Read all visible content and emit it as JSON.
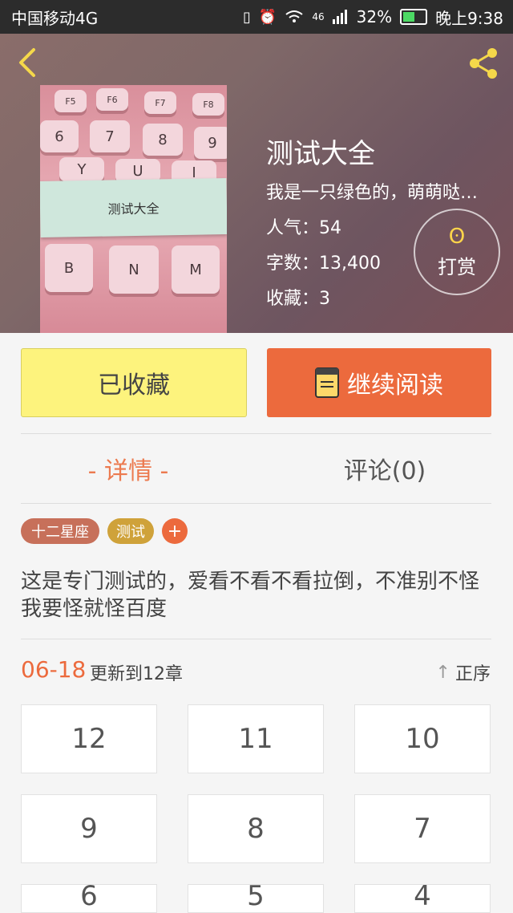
{
  "status_bar": {
    "carrier": "中国移动4G",
    "signal_label": "46",
    "battery_percent": "32%",
    "time": "晚上9:38",
    "icons": [
      "vibrate-icon",
      "alarm-icon",
      "wifi-icon",
      "signal-icon",
      "battery-icon"
    ]
  },
  "header": {
    "back_icon": "chevron-left-icon",
    "share_icon": "share-icon"
  },
  "cover": {
    "label": "测试大全",
    "keys_row1": [
      "F5",
      "F6",
      "F7",
      "F8"
    ],
    "keys_row2": [
      "6",
      "7",
      "8",
      "9"
    ],
    "keys_row3": [
      "Y",
      "U",
      "I"
    ],
    "keys_row4": [
      "B",
      "N",
      "M"
    ]
  },
  "book": {
    "title": "测试大全",
    "description": "我是一只绿色的，萌萌哒…",
    "popularity": "人气：54",
    "word_count": "字数：13,400",
    "favorites": "收藏：3"
  },
  "reward": {
    "label": "打赏",
    "icon": "ingot-icon"
  },
  "actions": {
    "collected_label": "已收藏",
    "continue_label": "继续阅读"
  },
  "tabs": {
    "detail": "- 详情 -",
    "comment": "评论(0)"
  },
  "tags": [
    {
      "label": "十二星座",
      "color": "#c7705a"
    },
    {
      "label": "测试",
      "color": "#cfa23a"
    }
  ],
  "tag_add_label": "+",
  "intro": "这是专门测试的，爱看不看不看拉倒，不准别不怪我要怪就怪百度",
  "update": {
    "date": "06-18",
    "text": "更新到12章",
    "sort_label": "正序"
  },
  "chapters": [
    "12",
    "11",
    "10",
    "9",
    "8",
    "7",
    "6",
    "5",
    "4"
  ],
  "colors": {
    "accent": "#ec6a3d",
    "collected_bg": "#fdf37d",
    "tab_active": "#ec7a4f"
  }
}
